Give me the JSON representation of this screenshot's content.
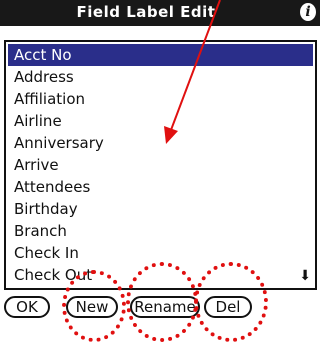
{
  "window": {
    "title": "Field Label Edit",
    "info_icon": "info-icon"
  },
  "list": {
    "selected_index": 0,
    "items": [
      "Acct No",
      "Address",
      "Affiliation",
      "Airline",
      "Anniversary",
      "Arrive",
      "Attendees",
      "Birthday",
      "Branch",
      "Check In",
      "Check Out"
    ]
  },
  "buttons": {
    "ok": "OK",
    "new": "New",
    "rename": "Rename",
    "del": "Del"
  },
  "annotation_color": "#e01010",
  "selection_color": "#2a2e8a"
}
